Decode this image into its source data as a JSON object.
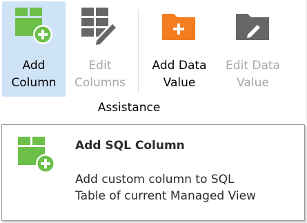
{
  "ribbon": {
    "buttons": {
      "add_column": {
        "line1": "Add",
        "line2": "Column"
      },
      "edit_columns": {
        "line1": "Edit",
        "line2": "Columns"
      },
      "add_data_value": {
        "line1": "Add Data",
        "line2": "Value"
      },
      "edit_data_value": {
        "line1": "Edit Data",
        "line2": "Value"
      }
    },
    "group_label": "Assistance"
  },
  "tooltip": {
    "title": "Add SQL Column",
    "description_line1": "Add custom column to SQL",
    "description_line2": "Table of current Managed View"
  },
  "icons": {
    "add_column": "table-add-icon",
    "edit_columns": "table-edit-icon",
    "add_data_value": "folder-add-icon",
    "edit_data_value": "folder-edit-icon"
  },
  "colors": {
    "selected_background": "#cfe3f7",
    "green": "#6cc04a",
    "orange": "#f47d20",
    "gray": "#666666",
    "disabled_text": "#a8a8a8"
  }
}
